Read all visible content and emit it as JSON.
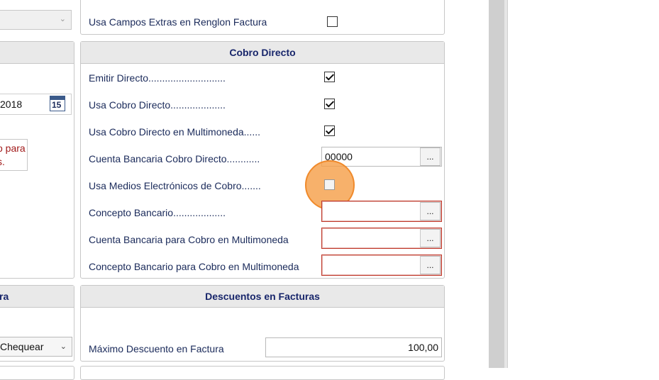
{
  "top_panel": {
    "row_label": "Usa Campos Extras en Renglon Factura",
    "row_checked": false
  },
  "cobro_directo": {
    "title": "Cobro Directo",
    "rows": [
      {
        "label": "Emitir Directo............................",
        "checked": true
      },
      {
        "label": "Usa Cobro Directo....................",
        "checked": true
      },
      {
        "label": "Usa Cobro Directo en Multimoneda......",
        "checked": true
      }
    ],
    "cuenta_bancaria": {
      "label": "Cuenta Bancaria Cobro Directo............",
      "value": "00000",
      "btn": "..."
    },
    "medios_electronicos": {
      "label": "Usa Medios Electrónicos de Cobro.......",
      "checked": false
    },
    "concepto_bancario": {
      "label": "Concepto Bancario...................",
      "value": "",
      "btn": "..."
    },
    "cuenta_multimoneda": {
      "label": "Cuenta Bancaria para Cobro en Multimoneda",
      "value": "",
      "btn": "..."
    },
    "concepto_multimoneda": {
      "label": "Concepto Bancario para Cobro en Multimoneda",
      "value": "",
      "btn": "..."
    }
  },
  "descuentos": {
    "title": "Descuentos en Facturas",
    "max_label": "Máximo Descuento en Factura",
    "max_value": "100,00"
  },
  "left_partial": {
    "date_text": "2018",
    "calendar_day": "15",
    "error_line1": "o para",
    "error_line2": "s.",
    "header_fragment": "ra",
    "select_value": "Chequear"
  },
  "colors": {
    "header_bg": "#e9e9e9",
    "header_text": "#18266b",
    "label_text": "#1a2a5a",
    "error_border": "#c0392b",
    "cursor_highlight": "#f5a04a"
  }
}
